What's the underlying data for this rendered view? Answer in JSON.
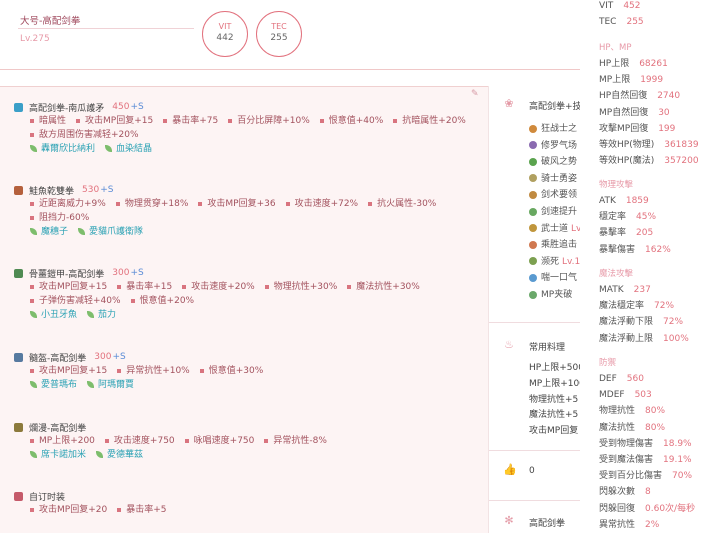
{
  "header": {
    "name": "大号-高配剑拳",
    "level": "Lv.275",
    "vit_label": "VIT",
    "vit_value": "442",
    "tec_label": "TEC",
    "tec_value": "255"
  },
  "colors": {
    "accent": "#e2727e",
    "panel_bg": "#fdf4f4",
    "crystal": "#2ca2b4",
    "s_blue": "#5a8cd6"
  },
  "equipment": [
    {
      "name": "高配剑拳-南瓜護矛",
      "value": "450",
      "s": "+S",
      "icon": "spear-icon",
      "attrs": [
        [
          "暗属性",
          "攻击MP回复+15",
          "暴击率+75",
          "百分比屏障+10%",
          "恨意值+40%",
          "抗暗属性+20%"
        ],
        [
          "敌方周围伤害减轻+20%"
        ]
      ],
      "crystals": [
        "轟爾欣比納利",
        "血染結晶"
      ]
    },
    {
      "name": "鮭魚乾雙拳",
      "value": "530",
      "s": "+S",
      "icon": "knuckle-icon",
      "attrs": [
        [
          "近距离威力+9%",
          "物理贯穿+18%",
          "攻击MP回复+36",
          "攻击速度+72%",
          "抗火属性-30%"
        ],
        [
          "阻挡力-60%"
        ]
      ],
      "crystals": [
        "魔穗子",
        "愛貓爪護衛隊"
      ]
    },
    {
      "name": "骨薑鎧甲-高配剑拳",
      "value": "300",
      "s": "+S",
      "icon": "armor-icon",
      "attrs": [
        [
          "攻击MP回复+15",
          "暴击率+15",
          "攻击速度+20%",
          "物理抗性+30%",
          "魔法抗性+30%"
        ],
        [
          "子弹伤害减轻+40%",
          "恨意值+20%"
        ]
      ],
      "crystals": [
        "小丑牙魚",
        "茄力"
      ]
    },
    {
      "name": "髓盔-高配剑拳",
      "value": "300",
      "s": "+S",
      "icon": "helmet-icon",
      "attrs": [
        [
          "攻击MP回复+15",
          "异常抗性+10%",
          "恨意值+30%"
        ]
      ],
      "crystals": [
        "愛普瑪布",
        "阿瑪爾賈"
      ]
    },
    {
      "name": "爛漫-高配剑拳",
      "value": "",
      "s": "",
      "icon": "ring-icon",
      "attrs": [
        [
          "MP上限+200",
          "攻击速度+750",
          "咏唱速度+750",
          "异常抗性-8%"
        ]
      ],
      "crystals": [
        "席卡諾加米",
        "愛德華茲"
      ]
    },
    {
      "name": "自订时装",
      "value": "",
      "s": "",
      "icon": "costume-icon",
      "attrs": [
        [
          "攻击MP回复+20",
          "暴击率+5"
        ]
      ],
      "crystals": []
    }
  ],
  "middle": {
    "skills_title": "高配剑拳+技",
    "skills": [
      {
        "icon": "skill-icon",
        "label": "狂战士之",
        "lv": ""
      },
      {
        "icon": "skill-icon",
        "label": "修罗气场",
        "lv": ""
      },
      {
        "icon": "skill-icon",
        "label": "破风之势",
        "lv": ""
      },
      {
        "icon": "skill-icon",
        "label": "骑士勇姿",
        "lv": ""
      },
      {
        "icon": "skill-icon",
        "label": "剑术要领",
        "lv": ""
      },
      {
        "icon": "skill-icon",
        "label": "剑速提升",
        "lv": ""
      },
      {
        "icon": "skill-icon",
        "label": "武士道",
        "lv": "Lv"
      },
      {
        "icon": "skill-icon",
        "label": "乘胜追击",
        "lv": ""
      },
      {
        "icon": "skill-icon",
        "label": "濒死",
        "lv": "Lv.1"
      },
      {
        "icon": "skill-icon",
        "label": "喘一口气",
        "lv": ""
      },
      {
        "icon": "skill-icon",
        "label": "MP夹破",
        "lv": ""
      }
    ],
    "food_title": "常用料理",
    "food": [
      "HP上限+500",
      "MP上限+100",
      "物理抗性+5",
      "魔法抗性+5",
      "攻击MP回复"
    ],
    "likes_count": "0",
    "footer_title": "高配剑拳"
  },
  "stats": {
    "top": [
      {
        "label": "VIT",
        "value": "452"
      },
      {
        "label": "TEC",
        "value": "255"
      }
    ],
    "sections": [
      {
        "title": "HP、MP",
        "rows": [
          {
            "label": "HP上限",
            "value": "68261"
          },
          {
            "label": "MP上限",
            "value": "1999"
          },
          {
            "label": "HP自然回復",
            "value": "2740"
          },
          {
            "label": "MP自然回復",
            "value": "30"
          },
          {
            "label": "攻擊MP回復",
            "value": "199"
          },
          {
            "label": "等效HP(物理)",
            "value": "361839"
          },
          {
            "label": "等效HP(魔法)",
            "value": "357200"
          }
        ]
      },
      {
        "title": "物理攻擊",
        "rows": [
          {
            "label": "ATK",
            "value": "1859"
          },
          {
            "label": "穩定率",
            "value": "45%"
          },
          {
            "label": "暴擊率",
            "value": "205"
          },
          {
            "label": "暴擊傷害",
            "value": "162%"
          }
        ]
      },
      {
        "title": "魔法攻擊",
        "rows": [
          {
            "label": "MATK",
            "value": "237"
          },
          {
            "label": "魔法穩定率",
            "value": "72%"
          },
          {
            "label": "魔法浮動下限",
            "value": "72%"
          },
          {
            "label": "魔法浮動上限",
            "value": "100%"
          }
        ]
      },
      {
        "title": "防禦",
        "rows": [
          {
            "label": "DEF",
            "value": "560"
          },
          {
            "label": "MDEF",
            "value": "503"
          },
          {
            "label": "物理抗性",
            "value": "80%"
          },
          {
            "label": "魔法抗性",
            "value": "80%"
          },
          {
            "label": "受到物理傷害",
            "value": "18.9%"
          },
          {
            "label": "受到魔法傷害",
            "value": "19.1%"
          },
          {
            "label": "受到百分比傷害",
            "value": "70%"
          },
          {
            "label": "閃躲次數",
            "value": "8"
          },
          {
            "label": "閃躲回復",
            "value": "0.60次/每秒"
          },
          {
            "label": "異常抗性",
            "value": "2%"
          }
        ]
      }
    ]
  }
}
